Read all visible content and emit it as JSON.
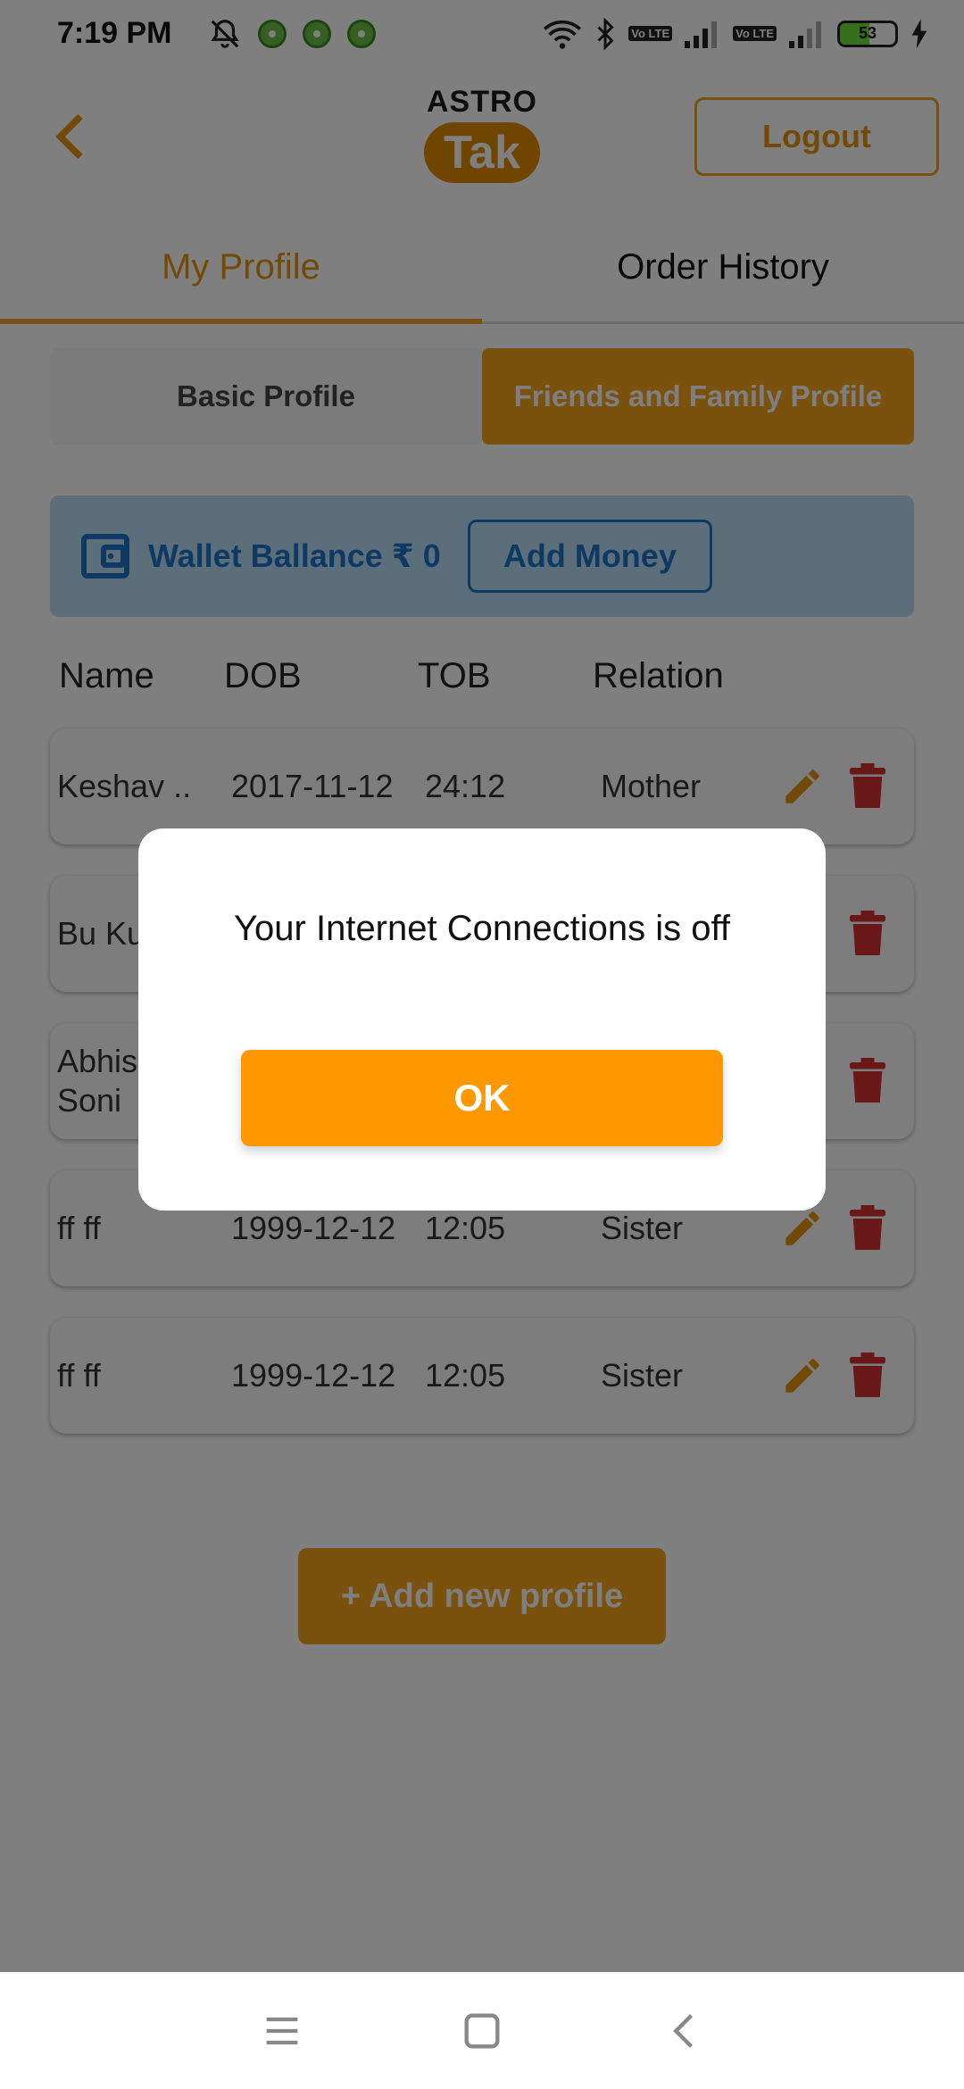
{
  "status_bar": {
    "time": "7:19 PM",
    "battery": "53",
    "volte_label": "Vo LTE"
  },
  "header": {
    "logo_top": "ASTRO",
    "logo_bottom": "Tak",
    "logout_label": "Logout"
  },
  "tabs": [
    {
      "label": "My Profile"
    },
    {
      "label": "Order History"
    }
  ],
  "subtabs": [
    {
      "label": "Basic Profile"
    },
    {
      "label": "Friends and Family Profile"
    }
  ],
  "wallet": {
    "text": "Wallet Ballance ₹ 0",
    "add_money_label": "Add Money"
  },
  "table": {
    "headers": [
      "Name",
      "DOB",
      "TOB",
      "Relation"
    ],
    "rows": [
      {
        "name": "Keshav ..",
        "dob": "2017-11-12",
        "tob": "24:12",
        "relation": "Mother"
      },
      {
        "name": "Bu Ku",
        "dob": "",
        "tob": "",
        "relation": ""
      },
      {
        "name": "Abhis Soni",
        "dob": "",
        "tob": "",
        "relation": ""
      },
      {
        "name": "ff ff",
        "dob": "1999-12-12",
        "tob": "12:05",
        "relation": "Sister"
      },
      {
        "name": "ff ff",
        "dob": "1999-12-12",
        "tob": "12:05",
        "relation": "Sister"
      }
    ]
  },
  "add_profile_label": "+ Add new profile",
  "dialog": {
    "message": "Your Internet Connections is off",
    "ok_label": "OK"
  },
  "colors": {
    "accent": "#f5a21b",
    "ok_button": "#ff9800",
    "wallet_bg": "#b7dcf5",
    "wallet_text": "#1a73c6",
    "delete": "#d32f2f"
  }
}
